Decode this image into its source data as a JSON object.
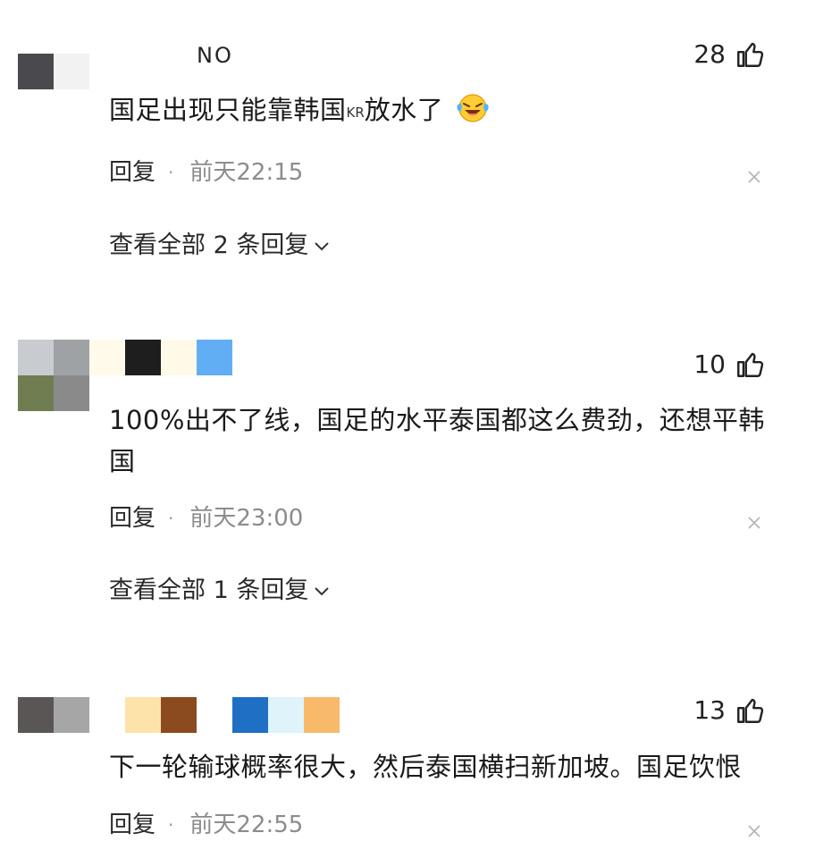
{
  "comments": [
    {
      "username": "NO",
      "likes": "28",
      "text_before": "国足出现只能靠韩国",
      "flag": "KR",
      "text_after": "放水了",
      "emoji": "laughing-crying-emoji",
      "reply_label": "回复",
      "dot": "·",
      "time": "前天22:15",
      "view_replies": "查看全部 2 条回复",
      "avatar_colors": [
        "#4a4a4e",
        "#f2f2f2"
      ],
      "name_colors": [
        "#fffaea",
        "#1e1e1e",
        "#fffae8",
        "#62aef5"
      ]
    },
    {
      "likes": "10",
      "text": "100%出不了线，国足的水平泰国都这么费劲，还想平韩国",
      "reply_label": "回复",
      "dot": "·",
      "time": "前天23:00",
      "view_replies": "查看全部 1 条回复",
      "avatar_colors": [
        "#c8ccd0",
        "#9fa2a5",
        "#6f7d51",
        "#8a8a8a"
      ],
      "name_colors": [
        "#fffaea",
        "#1e1e1e",
        "#fffae8",
        "#62aef5"
      ]
    },
    {
      "likes": "13",
      "text": "下一轮输球概率很大，然后泰国横扫新加坡。国足饮恨",
      "reply_label": "回复",
      "dot": "·",
      "time": "前天22:55",
      "avatar_colors": [
        "#5a5656",
        "#a6a6a6"
      ],
      "name_colors": [
        "#fde3aa",
        "#8c4a1f",
        "#ffffff",
        "#1f6fc5",
        "#dff3fb",
        "#f9b96b"
      ]
    }
  ],
  "icons": {
    "like": "thumbs-up-icon",
    "close": "close-icon",
    "expand": "chevron-down-icon"
  }
}
